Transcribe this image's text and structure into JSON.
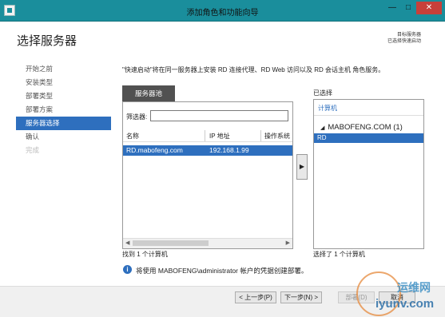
{
  "window": {
    "title": "添加角色和功能向导",
    "controls": {
      "minimize": "—",
      "maximize": "□",
      "close": "✕"
    }
  },
  "header": {
    "title": "选择服务器",
    "destination_label": "目标服务器",
    "destination_value": "已选择快速启动"
  },
  "steps": [
    {
      "label": "开始之前",
      "state": "normal"
    },
    {
      "label": "安装类型",
      "state": "normal"
    },
    {
      "label": "部署类型",
      "state": "normal"
    },
    {
      "label": "部署方案",
      "state": "normal"
    },
    {
      "label": "服务器选择",
      "state": "active"
    },
    {
      "label": "确认",
      "state": "normal"
    },
    {
      "label": "完成",
      "state": "disabled"
    }
  ],
  "description": "\"快速启动\"将在同一服务器上安装 RD 连接代理、RD Web 访问以及 RD 会话主机 角色服务。",
  "pool": {
    "tab_label": "服务器池",
    "filter_label": "筛选器:",
    "filter_value": "",
    "columns": [
      "名称",
      "IP 地址",
      "操作系统"
    ],
    "rows": [
      {
        "name": "RD.mabofeng.com",
        "ip": "192.168.1.99",
        "os": ""
      }
    ],
    "count_text": "找到 1 个计算机"
  },
  "add_button": "▶",
  "selected": {
    "title": "已选择",
    "column": "计算机",
    "group": "MABOFENG.COM (1)",
    "group_icon": "collapse-triangle",
    "items": [
      "RD"
    ],
    "count_text": "选择了 1 个计算机"
  },
  "info": {
    "icon": "i",
    "text": "将使用 MABOFENG\\administrator 帐户的凭据创建部署。"
  },
  "footer": {
    "prev": "< 上一步(P)",
    "next": "下一步(N) >",
    "deploy": "部署(D)",
    "cancel": "取消"
  },
  "watermark": {
    "line1": "运维网",
    "line2": "iyunv.com"
  },
  "colors": {
    "titlebar": "#1a8e9c",
    "selection": "#2e6fbe",
    "close": "#c7403a"
  }
}
